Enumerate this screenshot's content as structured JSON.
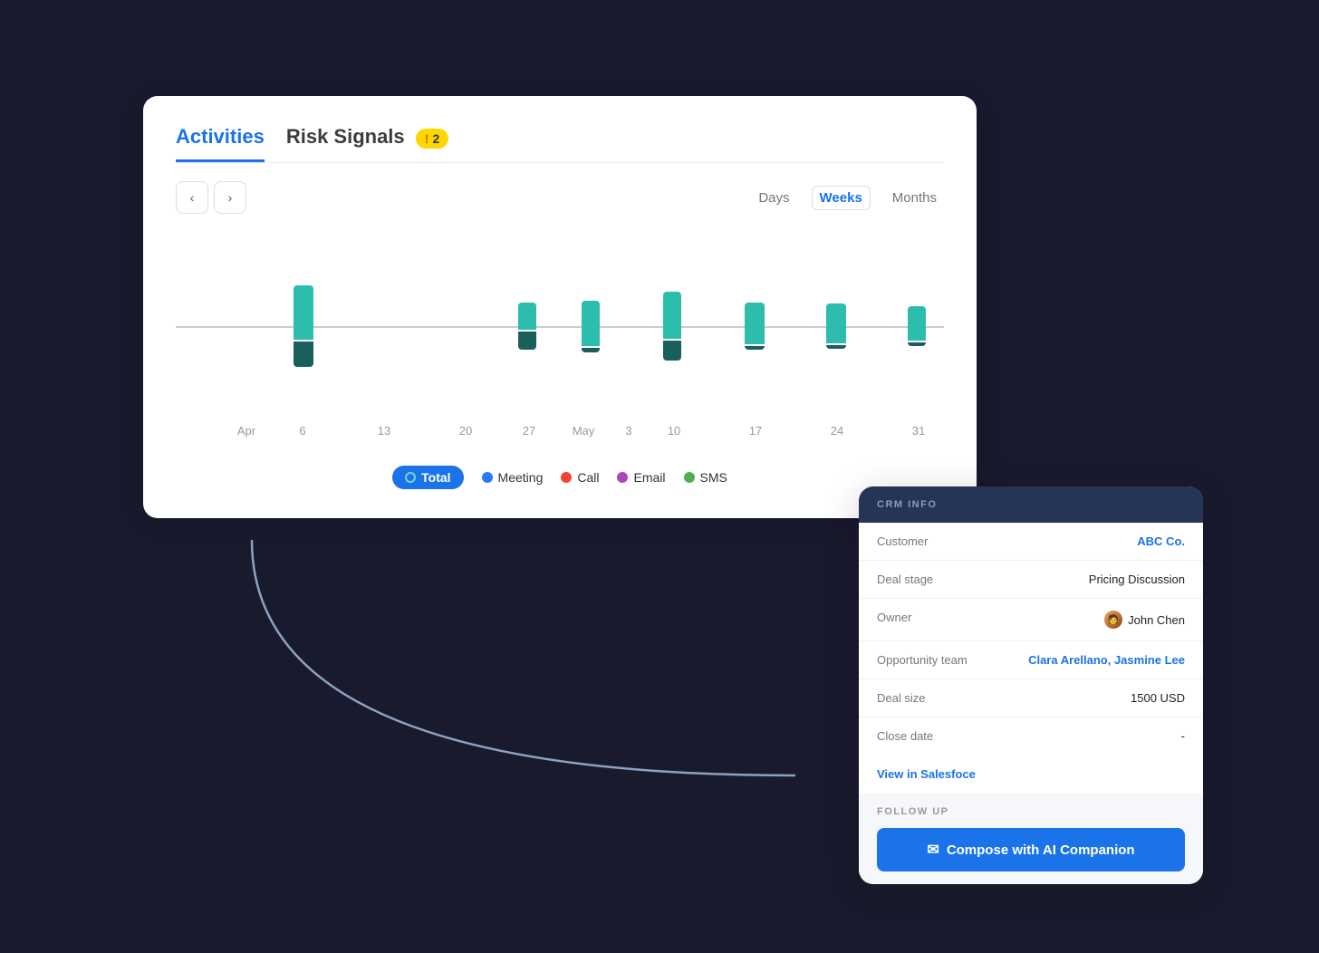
{
  "tabs": [
    {
      "id": "activities",
      "label": "Activities",
      "active": true
    },
    {
      "id": "risk-signals",
      "label": "Risk Signals",
      "active": false
    }
  ],
  "risk_badge": {
    "icon": "!",
    "count": "2"
  },
  "nav": {
    "prev_label": "‹",
    "next_label": "›"
  },
  "view_toggle": {
    "options": [
      "Days",
      "Weeks",
      "Months"
    ],
    "active": "Weeks"
  },
  "chart": {
    "x_labels": [
      "Apr",
      "6",
      "13",
      "20",
      "27",
      "May",
      "3",
      "10",
      "17",
      "24",
      "31"
    ]
  },
  "legend": {
    "items": [
      {
        "id": "total",
        "label": "Total",
        "color": "#1a73e8",
        "type": "outlined"
      },
      {
        "id": "meeting",
        "label": "Meeting",
        "color": "#2979ff"
      },
      {
        "id": "call",
        "label": "Call",
        "color": "#f44336"
      },
      {
        "id": "email",
        "label": "Email",
        "color": "#ab47bc"
      },
      {
        "id": "sms",
        "label": "SMS",
        "color": "#4caf50"
      }
    ]
  },
  "crm": {
    "section_label": "CRM INFO",
    "fields": [
      {
        "label": "Customer",
        "value": "ABC Co.",
        "type": "link"
      },
      {
        "label": "Deal stage",
        "value": "Pricing Discussion",
        "type": "normal"
      },
      {
        "label": "Owner",
        "value": "John Chen",
        "type": "owner"
      },
      {
        "label": "Opportunity team",
        "value": "Clara Arellano, Jasmine Lee",
        "type": "team-link"
      },
      {
        "label": "Deal size",
        "value": "1500 USD",
        "type": "normal"
      },
      {
        "label": "Close date",
        "value": "-",
        "type": "normal"
      }
    ],
    "view_link": "View in Salesfoce",
    "follow_up_label": "FOLLOW UP",
    "compose_button": "Compose with AI Companion"
  }
}
